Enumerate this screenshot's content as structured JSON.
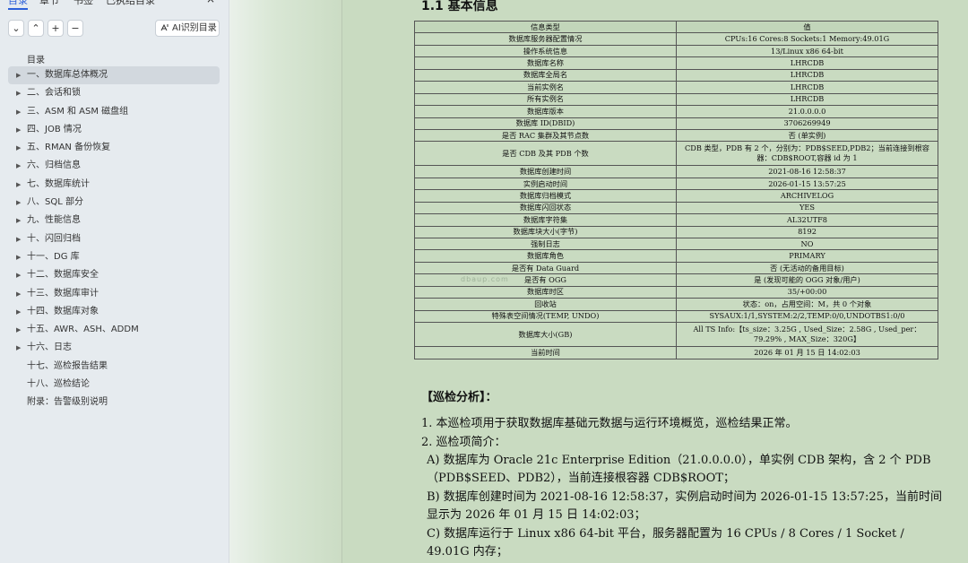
{
  "sidebar": {
    "tabs": [
      "目录",
      "章节",
      "书签",
      "已执结目录"
    ],
    "close_glyph": "×",
    "toolbar": {
      "collapse_glyph": "⌄",
      "expand_glyph": "⌃",
      "add_glyph": "+",
      "remove_glyph": "−",
      "ai_label": "AI识别目录"
    },
    "toc_title": "目录",
    "toc_items": [
      {
        "label": "一、数据库总体概况",
        "expandable": true,
        "active": true
      },
      {
        "label": "二、会话和锁",
        "expandable": true
      },
      {
        "label": "三、ASM 和 ASM 磁盘组",
        "expandable": true
      },
      {
        "label": "四、JOB 情况",
        "expandable": true
      },
      {
        "label": "五、RMAN 备份恢复",
        "expandable": true
      },
      {
        "label": "六、归档信息",
        "expandable": true
      },
      {
        "label": "七、数据库统计",
        "expandable": true
      },
      {
        "label": "八、SQL 部分",
        "expandable": true
      },
      {
        "label": "九、性能信息",
        "expandable": true
      },
      {
        "label": "十、闪回归档",
        "expandable": true
      },
      {
        "label": "十一、DG 库",
        "expandable": true
      },
      {
        "label": "十二、数据库安全",
        "expandable": true
      },
      {
        "label": "十三、数据库审计",
        "expandable": true
      },
      {
        "label": "十四、数据库对象",
        "expandable": true
      },
      {
        "label": "十五、AWR、ASH、ADDM",
        "expandable": true
      },
      {
        "label": "十六、日志",
        "expandable": true
      },
      {
        "label": "十七、巡检报告结果",
        "expandable": false
      },
      {
        "label": "十八、巡检结论",
        "expandable": false
      },
      {
        "label": "附录：告警级别说明",
        "expandable": false
      }
    ]
  },
  "document": {
    "heading": "1.1  基本信息",
    "table": {
      "headers": [
        "信息类型",
        "值"
      ],
      "rows": [
        [
          "数据库服务器配置情况",
          "CPUs:16  Cores:8  Sockets:1  Memory:49.01G"
        ],
        [
          "操作系统信息",
          "13/Linux x86 64-bit"
        ],
        [
          "数据库名称",
          "LHRCDB"
        ],
        [
          "数据库全局名",
          "LHRCDB"
        ],
        [
          "当前实例名",
          "LHRCDB"
        ],
        [
          "所有实例名",
          "LHRCDB"
        ],
        [
          "数据库版本",
          "21.0.0.0.0"
        ],
        [
          "数据库 ID(DBID)",
          "3706269949"
        ],
        [
          "是否 RAC 集群及其节点数",
          "否 (单实例)"
        ],
        [
          "是否 CDB 及其 PDB 个数",
          "CDB 类型，PDB 有 2 个，分别为：PDB$SEED,PDB2；当前连接到根容器：CDB$ROOT,容器 id 为 1"
        ],
        [
          "数据库创建时间",
          "2021-08-16 12:58:37"
        ],
        [
          "实例启动时间",
          "2026-01-15 13:57:25"
        ],
        [
          "数据库归档模式",
          "ARCHIVELOG"
        ],
        [
          "数据库闪回状态",
          "YES"
        ],
        [
          "数据库字符集",
          "AL32UTF8"
        ],
        [
          "数据库块大小(字节)",
          "8192"
        ],
        [
          "强制日志",
          "NO"
        ],
        [
          "数据库角色",
          "PRIMARY"
        ],
        [
          "是否有 Data Guard",
          "否 (无活动的备用目标)"
        ],
        [
          "是否有 OGG",
          "是 (发现可能的 OGG 对象/用户)"
        ],
        [
          "数据库时区",
          "35/+00:00"
        ],
        [
          "回收站",
          "状态：on，占用空间：M，共 0 个对象"
        ],
        [
          "特殊表空间情况(TEMP, UNDO)",
          "SYSAUX:1/1,SYSTEM:2/2,TEMP:0/0,UNDOTBS1:0/0"
        ],
        [
          "数据库大小(GB)",
          "All TS Info:【ts_size：3.25G , Used_Size：2.58G , Used_per：79.29% , MAX_Size：320G】"
        ],
        [
          "当前时间",
          "2026 年 01 月 15 日 14:02:03"
        ]
      ]
    },
    "watermark": "dbaup.com",
    "analysis_title": "【巡检分析】：",
    "paragraphs": [
      "1. 本巡检项用于获取数据库基础元数据与运行环境概览，巡检结果正常。",
      "2. 巡检项简介：",
      "A) 数据库为 Oracle 21c Enterprise Edition（21.0.0.0.0），单实例 CDB 架构，含 2 个 PDB（PDB$SEED、PDB2），当前连接根容器 CDB$ROOT；",
      "B) 数据库创建时间为 2021-08-16 12:58:37，实例启动时间为 2026-01-15 13:57:25，当前时间显示为 2026 年 01 月 15 日 14:02:03；",
      "C) 数据库运行于 Linux x86 64-bit 平台，服务器配置为 16 CPUs / 8 Cores / 1 Socket / 49.01G 内存；"
    ]
  }
}
